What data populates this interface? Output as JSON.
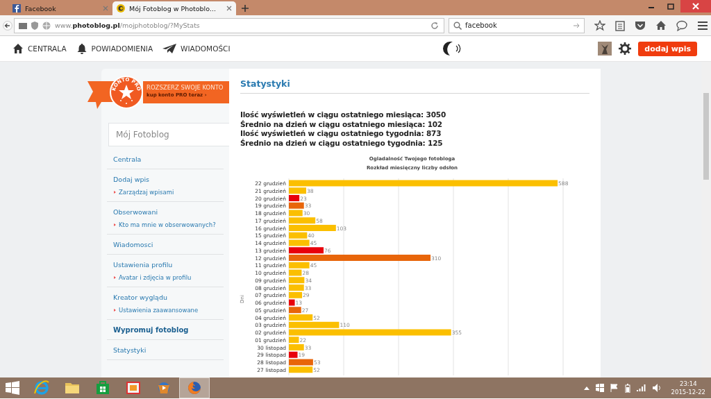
{
  "browser": {
    "tabs": [
      {
        "title": "Facebook",
        "selected": false
      },
      {
        "title": "Mój Fotoblog w Photoblo...",
        "selected": true
      }
    ],
    "url": "www.**photoblog.pl**/mojphotoblog/?MyStats",
    "search": "facebook"
  },
  "site_nav": {
    "items": [
      {
        "label": "CENTRALA"
      },
      {
        "label": "POWIADOMIENIA"
      },
      {
        "label": "WIADOMOŚCI"
      }
    ],
    "button": "dodaj wpis"
  },
  "sidebar": {
    "promo": {
      "badge": "KONTO PRO",
      "title": "ROZSZERZ SWOJE KONTO",
      "link": "kup konto PRO teraz ›"
    },
    "blog_title": "Mój Fotoblog",
    "menu": [
      {
        "label": "Centrala",
        "kind": "item"
      },
      {
        "label": "Dodaj wpis",
        "kind": "item"
      },
      {
        "label": "Zarządzaj wpisami",
        "kind": "sub"
      },
      {
        "label": "Obserwowani",
        "kind": "item"
      },
      {
        "label": "Kto ma mnie w obserwowanych?",
        "kind": "sub"
      },
      {
        "label": "Wiadomosci",
        "kind": "item"
      },
      {
        "label": "Ustawienia profilu",
        "kind": "item"
      },
      {
        "label": "Avatar i zdjęcia w profilu",
        "kind": "sub"
      },
      {
        "label": "Kreator wyglądu",
        "kind": "item"
      },
      {
        "label": "Ustawienia zaawansowane",
        "kind": "sub"
      },
      {
        "label": "Wypromuj fotoblog",
        "kind": "highlight"
      },
      {
        "label": "Statystyki",
        "kind": "item"
      }
    ]
  },
  "main": {
    "heading": "Statystyki",
    "stats": [
      "Ilość wyświetleń w ciągu ostatniego miesiąca: 3050",
      "Średnio na dzień w ciągu ostatniego miesiąca: 102",
      "Ilość wyświetleń w ciągu ostatniego tygodnia: 873",
      "Średnio na dzień w ciągu ostatniego tygodnia: 125"
    ],
    "chart_data": {
      "type": "bar",
      "orientation": "horizontal",
      "title": "Ogladalność Twojego fotobloga",
      "subtitle": "Rozkład miesięczny liczby odsłon",
      "ylabel": "Dni",
      "xlim": [
        0,
        600
      ],
      "data_labels": true,
      "categories": [
        "22 grudzień",
        "21 grudzień",
        "20 grudzień",
        "19 grudzień",
        "18 grudzień",
        "17 grudzień",
        "16 grudzień",
        "15 grudzień",
        "14 grudzień",
        "13 grudzień",
        "12 grudzień",
        "11 grudzień",
        "10 grudzień",
        "09 grudzień",
        "08 grudzień",
        "07 grudzień",
        "06 grudzień",
        "05 grudzień",
        "04 grudzień",
        "03 grudzień",
        "02 grudzień",
        "01 grudzień",
        "30 listopad",
        "29 listopad",
        "28 listopad",
        "27 listopad"
      ],
      "series": [
        {
          "color": "#fbbf00",
          "values": [
            588,
            38,
            null,
            null,
            30,
            58,
            103,
            40,
            45,
            null,
            null,
            45,
            28,
            34,
            33,
            29,
            null,
            null,
            52,
            110,
            355,
            22,
            33,
            null,
            null,
            52
          ]
        },
        {
          "color": "#e8000b",
          "values": [
            null,
            null,
            23,
            null,
            null,
            null,
            null,
            null,
            null,
            76,
            null,
            null,
            null,
            null,
            null,
            null,
            13,
            null,
            null,
            null,
            null,
            null,
            null,
            19,
            null,
            null
          ]
        },
        {
          "color": "#e8650a",
          "values": [
            null,
            null,
            null,
            33,
            null,
            null,
            null,
            null,
            null,
            null,
            310,
            null,
            null,
            null,
            null,
            null,
            null,
            27,
            null,
            null,
            null,
            null,
            null,
            null,
            53,
            null
          ]
        }
      ]
    }
  },
  "taskbar": {
    "apps": [
      {
        "kind": "ie",
        "selected": false
      },
      {
        "kind": "folder",
        "selected": false
      },
      {
        "kind": "store",
        "selected": false
      },
      {
        "kind": "photos",
        "selected": false
      },
      {
        "kind": "media",
        "selected": false
      },
      {
        "kind": "firefox",
        "selected": true
      }
    ],
    "time": "23:14",
    "date": "2015-12-22"
  }
}
